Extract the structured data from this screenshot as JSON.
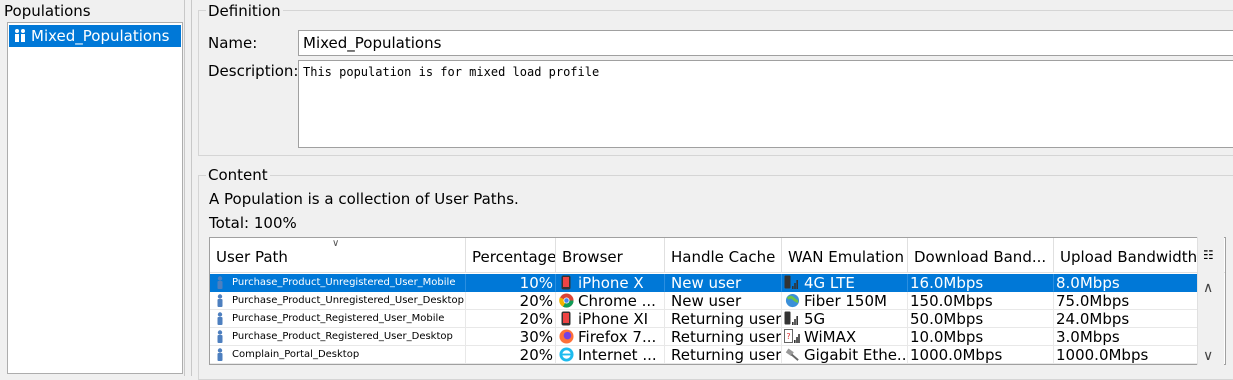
{
  "populations": {
    "title": "Populations",
    "items": [
      {
        "label": "Mixed_Populations",
        "selected": true,
        "icon": "population-icon"
      }
    ]
  },
  "definition": {
    "title": "Definition",
    "name_label": "Name:",
    "name_value": "Mixed_Populations",
    "description_label": "Description:",
    "description_value": "This population is for mixed load profile"
  },
  "content": {
    "title": "Content",
    "description": "A Population is a collection of User Paths.",
    "total": "Total: 100%"
  },
  "table": {
    "columns": [
      "User Path",
      "Percentage",
      "Browser",
      "Handle Cache",
      "WAN Emulation",
      "Download Band...",
      "Upload Bandwidth"
    ],
    "rows": [
      {
        "path": "Purchase_Product_Unregistered_User_Mobile",
        "pct": "10%",
        "browser": "iPhone X",
        "browser_icon": "iphone-icon",
        "cache": "New user",
        "wan": "4G LTE",
        "wan_icon": "mobile-signal-icon",
        "down": "16.0Mbps",
        "up": "8.0Mbps",
        "selected": true
      },
      {
        "path": "Purchase_Product_Unregistered_User_Desktop",
        "pct": "20%",
        "browser": "Chrome ...",
        "browser_icon": "chrome-icon",
        "cache": "New user",
        "wan": "Fiber 150M",
        "wan_icon": "globe-icon",
        "down": "150.0Mbps",
        "up": "75.0Mbps",
        "selected": false
      },
      {
        "path": "Purchase_Product_Registered_User_Mobile",
        "pct": "20%",
        "browser": "iPhone XI",
        "browser_icon": "iphone-icon",
        "cache": "Returning user",
        "wan": "5G",
        "wan_icon": "mobile-signal-icon",
        "down": "50.0Mbps",
        "up": "24.0Mbps",
        "selected": false
      },
      {
        "path": "Purchase_Product_Registered_User_Desktop",
        "pct": "30%",
        "browser": "Firefox 7...",
        "browser_icon": "firefox-icon",
        "cache": "Returning user",
        "wan": "WiMAX",
        "wan_icon": "wimax-icon",
        "down": "10.0Mbps",
        "up": "3.0Mbps",
        "selected": false
      },
      {
        "path": "Complain_Portal_Desktop",
        "pct": "20%",
        "browser": "Internet ...",
        "browser_icon": "internet-explorer-icon",
        "cache": "Returning user",
        "wan": "Gigabit Ethe...",
        "wan_icon": "ethernet-cable-icon",
        "down": "1000.0Mbps",
        "up": "1000.0Mbps",
        "selected": false
      }
    ]
  },
  "colors": {
    "selection": "#0078d7",
    "panel_bg": "#f0f0f0"
  }
}
